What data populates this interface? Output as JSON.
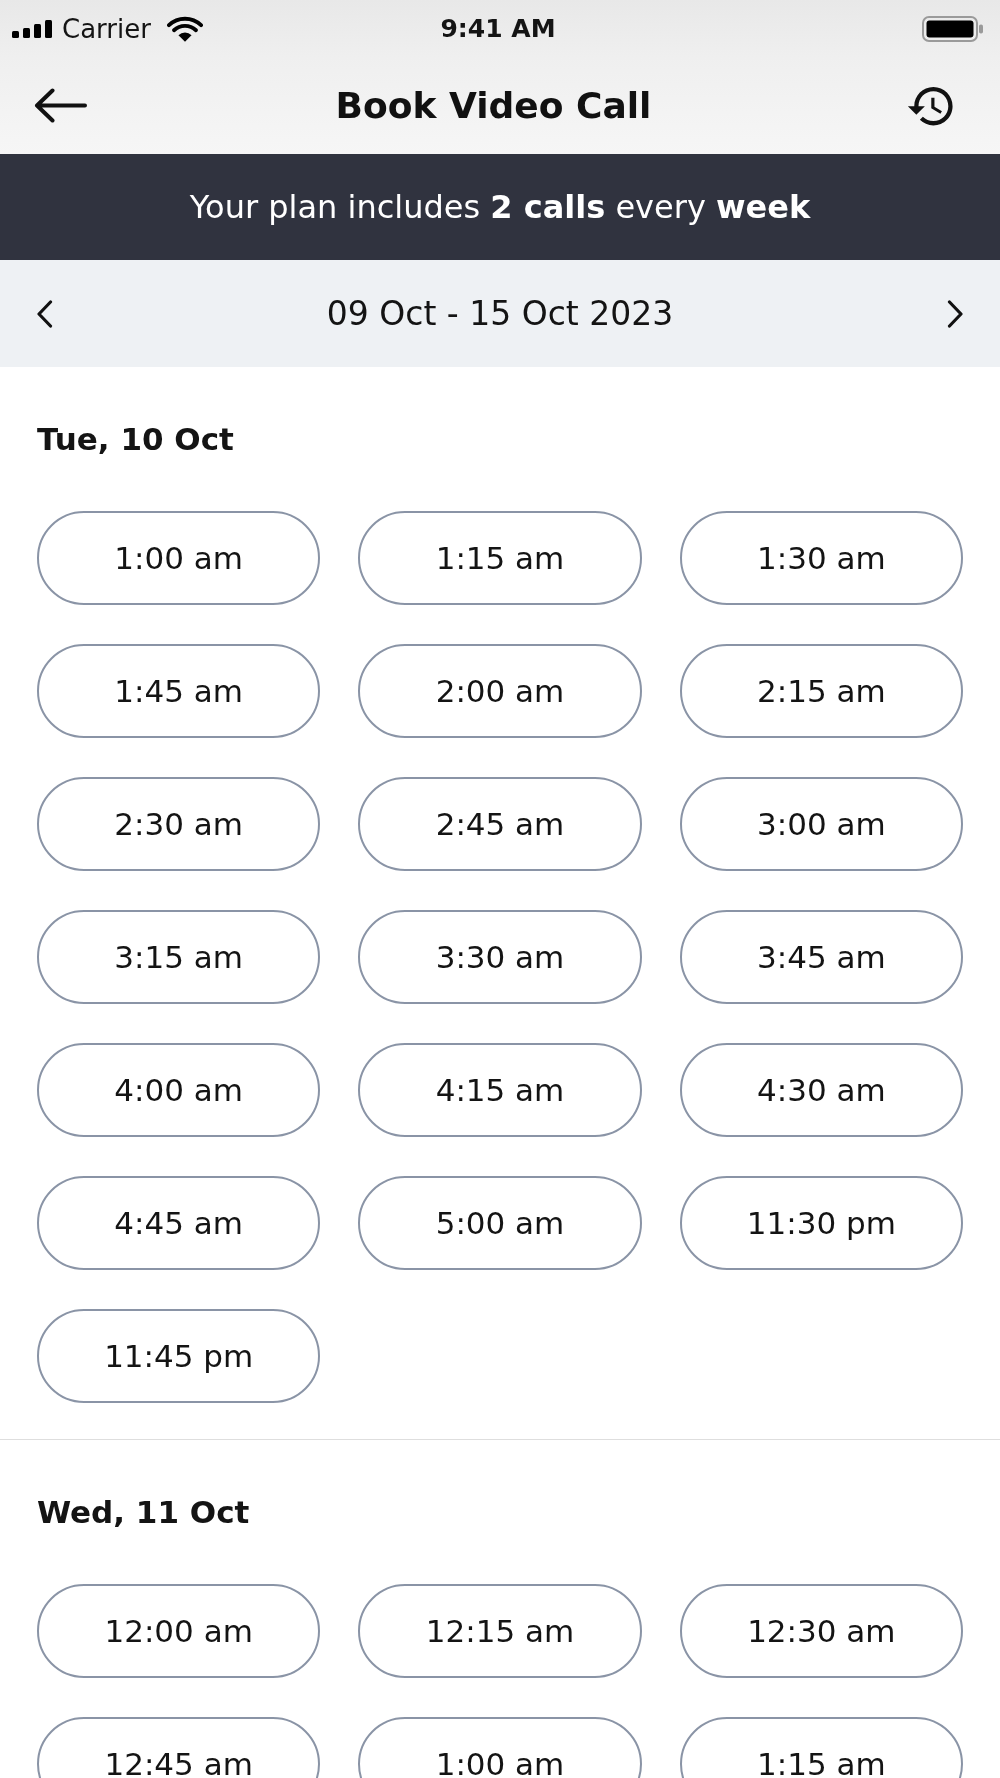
{
  "status_bar": {
    "carrier": "Carrier",
    "time": "9:41 AM"
  },
  "header": {
    "title": "Book Video Call"
  },
  "plan_banner": {
    "text": "Your plan includes **2 calls** every **week**"
  },
  "week_selector": {
    "range": "09 Oct - 15 Oct 2023"
  },
  "days": [
    {
      "heading": "Tue, 10 Oct",
      "slots": [
        "1:00 am",
        "1:15 am",
        "1:30 am",
        "1:45 am",
        "2:00 am",
        "2:15 am",
        "2:30 am",
        "2:45 am",
        "3:00 am",
        "3:15 am",
        "3:30 am",
        "3:45 am",
        "4:00 am",
        "4:15 am",
        "4:30 am",
        "4:45 am",
        "5:00 am",
        "11:30 pm",
        "11:45 pm"
      ]
    },
    {
      "heading": "Wed, 11 Oct",
      "slots": [
        "12:00 am",
        "12:15 am",
        "12:30 am",
        "12:45 am",
        "1:00 am",
        "1:15 am"
      ]
    }
  ]
}
